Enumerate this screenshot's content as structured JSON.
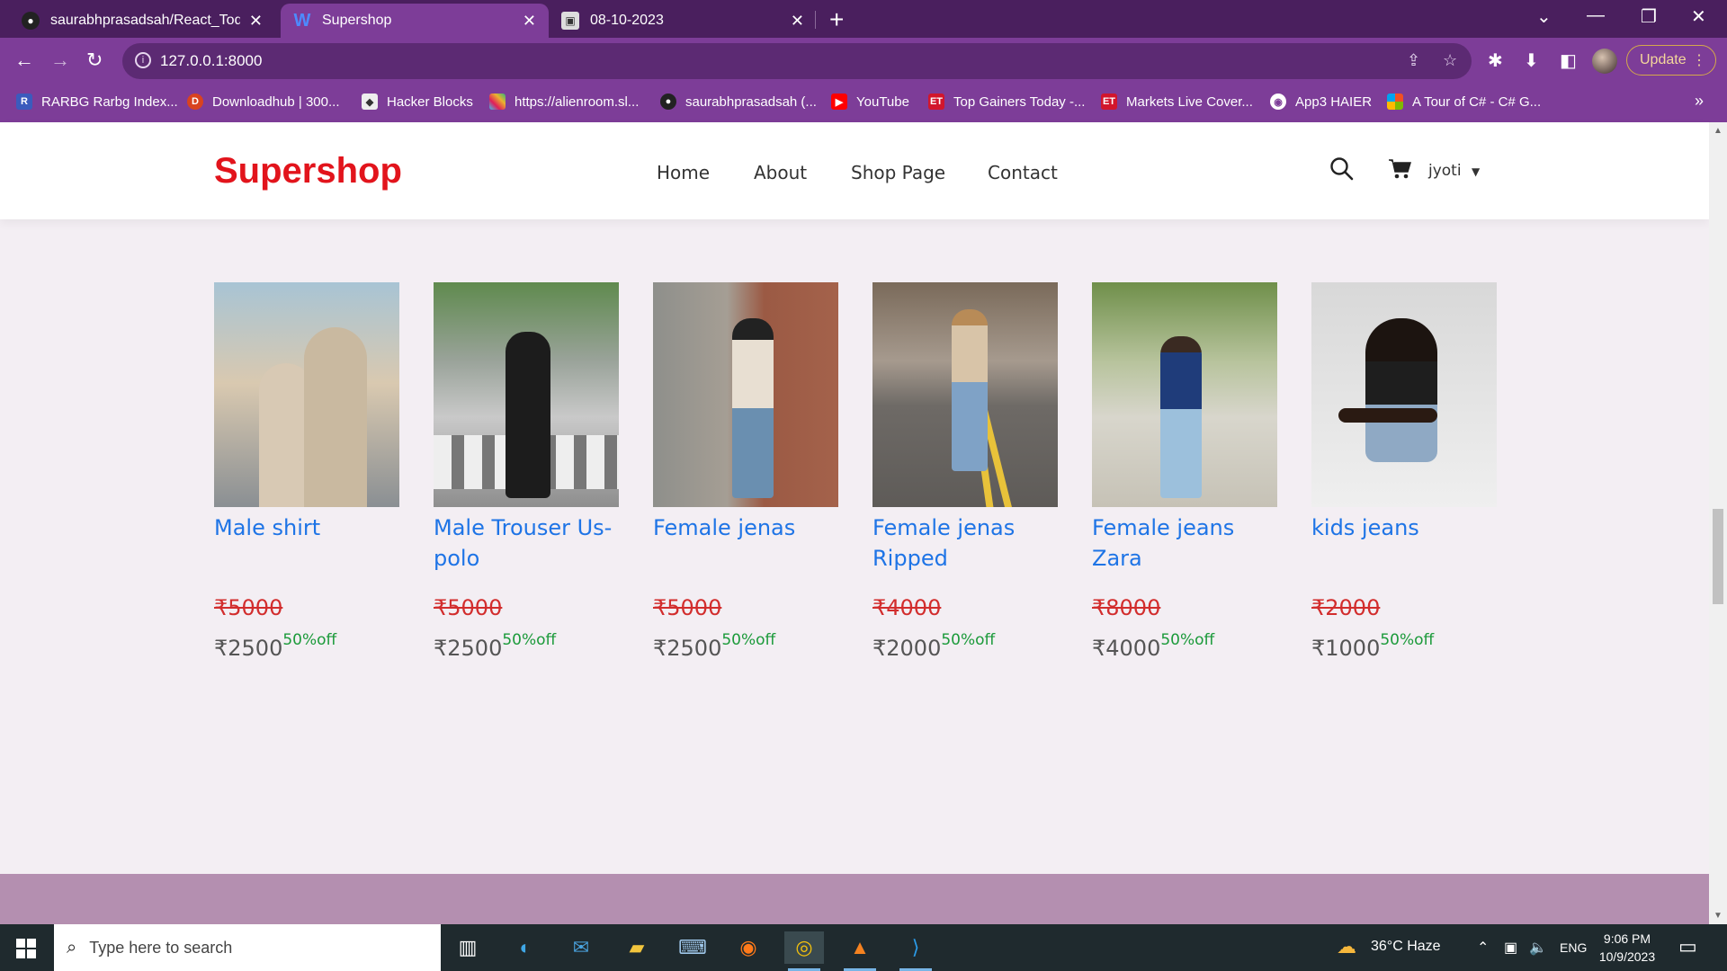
{
  "browser": {
    "tabs": [
      {
        "title": "saurabhprasadsah/React_Todo-App",
        "active": false
      },
      {
        "title": "Supershop",
        "active": true
      },
      {
        "title": "08-10-2023",
        "active": false
      }
    ],
    "url": "127.0.0.1:8000",
    "update_label": "Update",
    "bookmarks": [
      "RARBG Rarbg Index...",
      "Downloadhub | 300...",
      "Hacker Blocks",
      "https://alienroom.sl...",
      "saurabhprasadsah (...",
      "YouTube",
      "Top Gainers Today -...",
      "Markets Live Cover...",
      "App3 HAIER",
      "A Tour of C# - C# G..."
    ]
  },
  "site": {
    "logo": "Supershop",
    "nav": [
      "Home",
      "About",
      "Shop Page",
      "Contact"
    ],
    "user": "jyoti"
  },
  "products": [
    {
      "name": "Male shirt",
      "old_price": "₹5000",
      "price": "₹2500",
      "discount": "50%off"
    },
    {
      "name": "Male Trouser Us-polo",
      "old_price": "₹5000",
      "price": "₹2500",
      "discount": "50%off"
    },
    {
      "name": "Female jenas",
      "old_price": "₹5000",
      "price": "₹2500",
      "discount": "50%off"
    },
    {
      "name": "Female jenas Ripped",
      "old_price": "₹4000",
      "price": "₹2000",
      "discount": "50%off"
    },
    {
      "name": "Female jeans Zara",
      "old_price": "₹8000",
      "price": "₹4000",
      "discount": "50%off"
    },
    {
      "name": "kids jeans",
      "old_price": "₹2000",
      "price": "₹1000",
      "discount": "50%off"
    }
  ],
  "taskbar": {
    "search_placeholder": "Type here to search",
    "weather": "36°C  Haze",
    "lang": "ENG",
    "time": "9:06 PM",
    "date": "10/9/2023"
  },
  "colors": {
    "logo": "#e2141c",
    "product_name": "#1e74e6",
    "old_price": "#d22d2d",
    "discount": "#1b9a3a",
    "browser_frame": "#7d3d98"
  }
}
